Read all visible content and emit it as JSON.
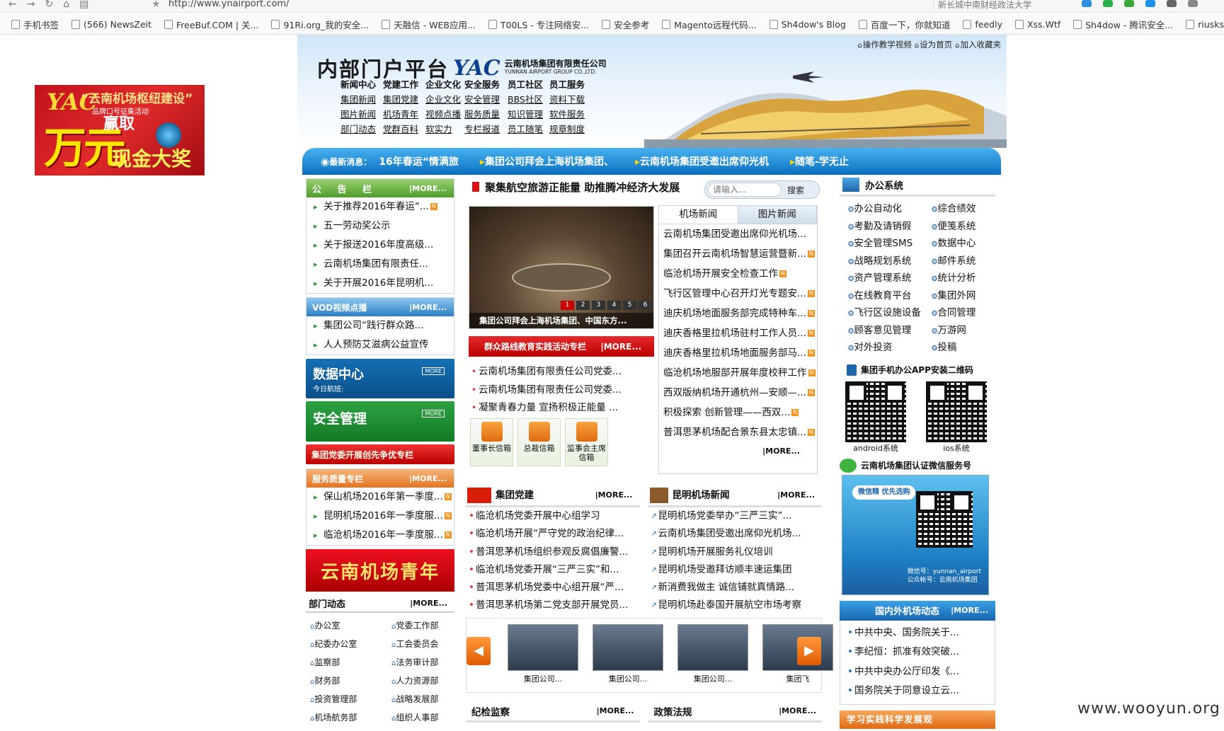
{
  "browser": {
    "url": "http://www.ynairport.com/",
    "search_text": "新长城中南财经政法大学",
    "bookmarks": [
      "手机书签",
      "(566) NewsZeit",
      "FreeBuf.COM | 关...",
      "91Ri.org_我的安全...",
      "天融信 - WEB应用...",
      "T00LS - 专注网络安...",
      "安全参考",
      "Magento远程代码...",
      "Sh4dow's Blog",
      "百度一下，你就知道",
      "feedly",
      "Xss.Wtf",
      "Sh4dow - 腾讯安全...",
      "riusksk'"
    ]
  },
  "ad": {
    "slogan": "“云南机场枢纽建设”",
    "sub": "品牌口号征集活动",
    "big": "万元",
    "win": "赢取",
    "prize": "现金大奖"
  },
  "header": {
    "title": "内部门户平台",
    "logo_mark": "YAC",
    "company_cn": "云南机场集团有限责任公司",
    "company_en": "YUNNAN AIRPORT GROUP CO.,LTD.",
    "toplinks": [
      "操作教学视频",
      "设为首页",
      "加入收藏夹"
    ],
    "menu": [
      [
        "新闻中心",
        "党建工作",
        "企业文化",
        "安全服务",
        "员工社区",
        "员工服务"
      ],
      [
        "集团新闻",
        "集团党建",
        "企业文化",
        "安全管理",
        "BBS社区",
        "资料下载"
      ],
      [
        "图片新闻",
        "机场青年",
        "视频点播",
        "服务质量",
        "知识管理",
        "软件服务"
      ],
      [
        "部门动态",
        "党群百科",
        "软实力",
        "专栏报道",
        "员工随笔",
        "规章制度"
      ]
    ]
  },
  "ticker": {
    "label": "最新消息：",
    "items": [
      "16年春运“情满旅",
      "集团公司拜会上海机场集团、",
      "云南机场集团受邀出席仰光机",
      "随笔-学无止"
    ]
  },
  "left": {
    "notice": {
      "title": "公 告 栏",
      "more": "|MORE...",
      "items": [
        "关于推荐2016年春运“...",
        "五一劳动奖公示",
        "关于报送2016年度高级...",
        "云南机场集团有限责任...",
        "关于开展2016年昆明机..."
      ]
    },
    "vod": {
      "title": "VOD视频点播",
      "more": "|MORE...",
      "items": [
        "集团公司“践行群众路...",
        "人人预防艾滋病公益宣传"
      ]
    },
    "datacenter": {
      "title": "数据中心",
      "sub": "今日航班:",
      "more": "MORE"
    },
    "safety": {
      "title": "安全管理",
      "more": "MORE"
    },
    "party_banner": "集团党委开展创先争优专栏",
    "service": {
      "title": "服务质量专栏",
      "more": "|MORE...",
      "items": [
        "保山机场2016年第一季度...",
        "昆明机场2016年一季度服...",
        "临沧机场2016年一季度服..."
      ]
    },
    "youth": "云南机场青年",
    "dept": {
      "title": "部门动态",
      "more": "|MORE...",
      "items": [
        "办公室",
        "党委工作部",
        "纪委办公室",
        "工会委员会",
        "监察部",
        "法务审计部",
        "财务部",
        "人力资源部",
        "投资管理部",
        "战略发展部",
        "机场航务部",
        "组织人事部"
      ]
    }
  },
  "mid": {
    "headline": "聚集航空旅游正能量 助推腾冲经济大发展",
    "search": {
      "placeholder": "请输入...",
      "button": "搜索"
    },
    "focus": {
      "caption": "集团公司拜会上海机场集团、中国东方...",
      "dots": [
        "1",
        "2",
        "3",
        "4",
        "5",
        "6"
      ]
    },
    "mass": {
      "title": "群众路线教育实践活动专栏",
      "more": "|MORE..."
    },
    "redlist": [
      "云南机场集团有限责任公司党委...",
      "云南机场集团有限责任公司党委...",
      "凝聚青春力量 宣扬积极正能量 ..."
    ],
    "mail": [
      "董事长信箱",
      "总裁信箱",
      "监事会主席信箱"
    ],
    "tabs": [
      "机场新闻",
      "图片新闻"
    ],
    "news": [
      "云南机场集团受邀出席仰光机场...",
      "集团召开云南机场智慧运营暨新...",
      "临沧机场开展安全检查工作",
      "飞行区管理中心召开灯光专题安...",
      "迪庆机场地面服务部完成特种车...",
      "迪庆香格里拉机场驻村工作人员...",
      "迪庆香格里拉机场地面服务部马...",
      "临沧机场地服部开展年度校秤工作",
      "西双版纳机场开通杭州—安顺—...",
      "积极探索 创新管理——西双...",
      "普洱思茅机场配合景东县太忠镇..."
    ],
    "news_more": "|MORE...",
    "party": {
      "title": "集团党建",
      "more": "|MORE...",
      "items": [
        "临沧机场党委开展中心组学习",
        "临沧机场开展“严守党的政治纪律...",
        "普洱思茅机场组织参观反腐倡廉警...",
        "临沧机场党委开展“三严三实”和...",
        "普洱思茅机场党委中心组开展“严...",
        "普洱思茅机场第二党支部开展党员..."
      ]
    },
    "kmnews": {
      "title": "昆明机场新闻",
      "more": "|MORE...",
      "items": [
        "昆明机场党委举办“三严三实”...",
        "云南机场集团受邀出席仰光机场...",
        "昆明机场开展服务礼仪培训",
        "昆明机场受邀拜访顺丰速运集团",
        "新消费我做主 诚信铺就真情路...",
        "昆明机场赴泰国开展航空市场考察"
      ]
    },
    "carousel": [
      "集团公司...",
      "集团公司...",
      "集团公司...",
      "集团飞"
    ],
    "discipline": {
      "title": "纪检监察",
      "more": "|MORE..."
    },
    "policy": {
      "title": "政策法规",
      "more": "|MORE..."
    }
  },
  "right": {
    "office": {
      "title": "办公系统",
      "items": [
        "办公自动化",
        "综合绩效",
        "考勤及请销假",
        "便笺系统",
        "安全管理SMS",
        "数据中心",
        "战略规划系统",
        "邮件系统",
        "资产管理系统",
        "统计分析",
        "在线教育平台",
        "集团外网",
        "飞行区设施设备",
        "合同管理",
        "顾客意见管理",
        "万游网",
        "对外投资",
        "投稿"
      ]
    },
    "app": {
      "title": "集团手机办公APP安装二维码",
      "android": "android系统",
      "ios": "ios系统"
    },
    "wechat": {
      "title": "云南机场集团认证微信服务号",
      "tag": "微信精 优先选购",
      "id": "微信号：yunnan_airport",
      "name": "公众帐号：云南机场集团"
    },
    "airports": {
      "title": "国内外机场动态",
      "more": "|MORE...",
      "items": [
        "中共中央、国务院关于...",
        "李纪恒：抓准有效突破...",
        "中共中央办公厅印发《...",
        "国务院关于同意设立云..."
      ]
    },
    "study": "学习实践科学发展观"
  },
  "watermark": "www.wooyun.org"
}
